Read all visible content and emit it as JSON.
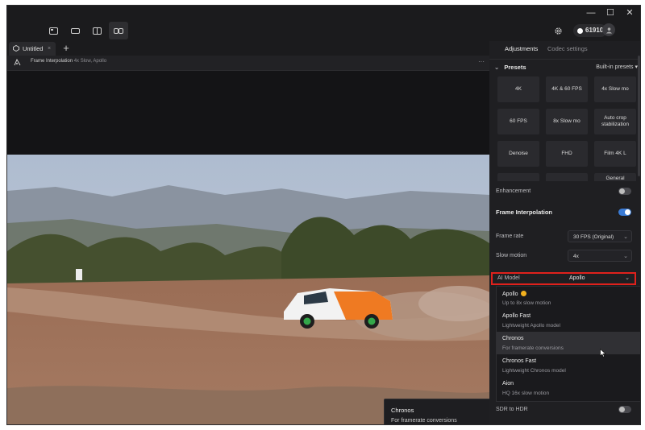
{
  "window": {
    "controls": {
      "minimize": "—",
      "maximize": "☐",
      "close": "✕"
    }
  },
  "toolbar": {
    "credits": "61910"
  },
  "tabs": [
    {
      "label": "Untitled"
    }
  ],
  "job": {
    "title": "Frame Interpolation",
    "details": "4x Slow, Apollo"
  },
  "panel": {
    "tabs": [
      "Adjustments",
      "Codec settings"
    ],
    "presets_label": "Presets",
    "presets_source": "Built-in presets",
    "presets": [
      "4K",
      "4K & 60 FPS",
      "4x Slow mo",
      "60 FPS",
      "8x Slow mo",
      "Auto crop stabilization",
      "Denoise",
      "FHD",
      "Film 4K L",
      "",
      "",
      "General"
    ],
    "enhancement_label": "Enhancement",
    "enhancement_on": false,
    "frame_interp_label": "Frame Interpolation",
    "frame_interp_on": true,
    "frame_rate_label": "Frame rate",
    "frame_rate_value": "30 FPS (Original)",
    "slow_motion_label": "Slow motion",
    "slow_motion_value": "4x",
    "ai_model_label": "AI Model",
    "ai_model_value": "Apollo",
    "sdr_label": "SDR to HDR",
    "sdr_on": false
  },
  "dropdown_options": [
    {
      "name": "Apollo",
      "desc": "Up to 8x slow motion",
      "highlighted": false
    },
    {
      "name": "Apollo Fast",
      "desc": "Lightweight Apollo model",
      "highlighted": false
    },
    {
      "name": "Chronos",
      "desc": "For framerate conversions",
      "highlighted": true
    },
    {
      "name": "Chronos Fast",
      "desc": "Lightweight Chronos model",
      "highlighted": false
    },
    {
      "name": "Aion",
      "desc": "HQ 16x slow motion",
      "highlighted": false
    }
  ],
  "tooltip": {
    "title": "Chronos",
    "desc": "For framerate conversions"
  },
  "colors": {
    "accent": "#3a7bd5",
    "highlight_border": "#e0211c",
    "premium_badge": "#f2b01e"
  }
}
